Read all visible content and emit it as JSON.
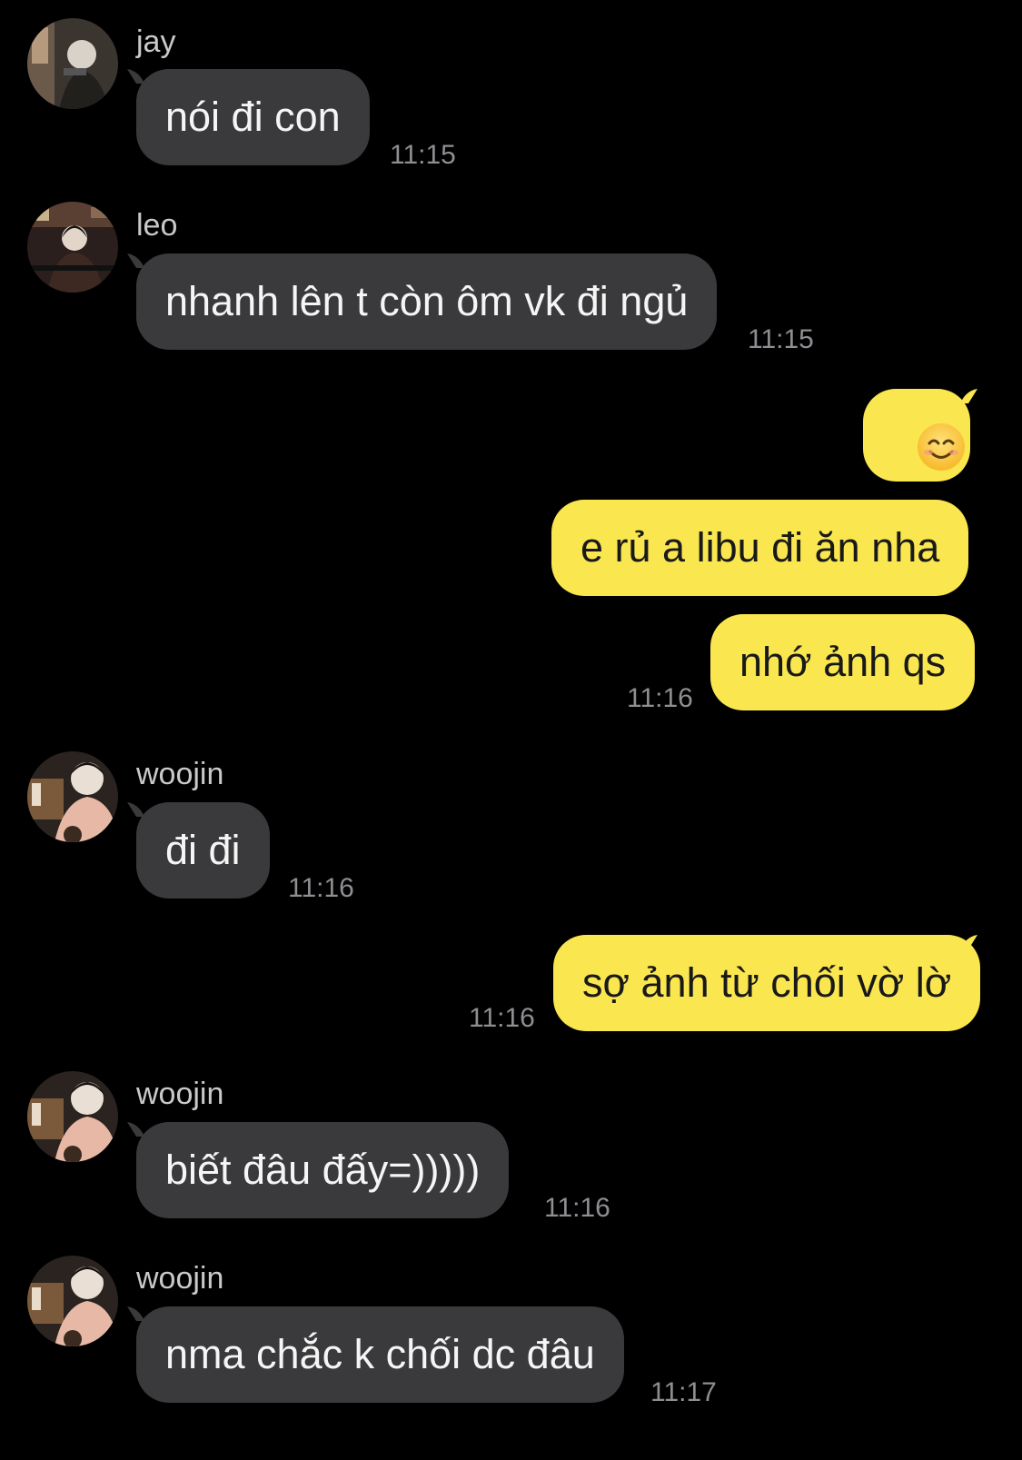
{
  "messages": [
    {
      "sender": "jay",
      "text": "nói đi con",
      "time": "11:15"
    },
    {
      "sender": "leo",
      "text": "nhanh lên t còn ôm vk đi ngủ",
      "time": "11:15"
    },
    {
      "sender": "me",
      "text": "",
      "emoji": "smiling-face-icon"
    },
    {
      "sender": "me",
      "text": "e rủ a libu đi ăn nha"
    },
    {
      "sender": "me",
      "text": "nhớ ảnh qs",
      "time": "11:16"
    },
    {
      "sender": "woojin",
      "text": "đi đi",
      "time": "11:16"
    },
    {
      "sender": "me",
      "text": "sợ ảnh từ chối vờ lờ",
      "time": "11:16"
    },
    {
      "sender": "woojin",
      "text": "biết đâu đấy=)))))",
      "time": "11:16"
    },
    {
      "sender": "woojin",
      "text": "nma chắc k chối dc đâu",
      "time": "11:17"
    }
  ],
  "colors": {
    "background": "#000000",
    "incoming_bubble": "#3a3a3c",
    "outgoing_bubble": "#fae64f",
    "timestamp": "#8e8e93",
    "name": "#c9c9c9"
  }
}
